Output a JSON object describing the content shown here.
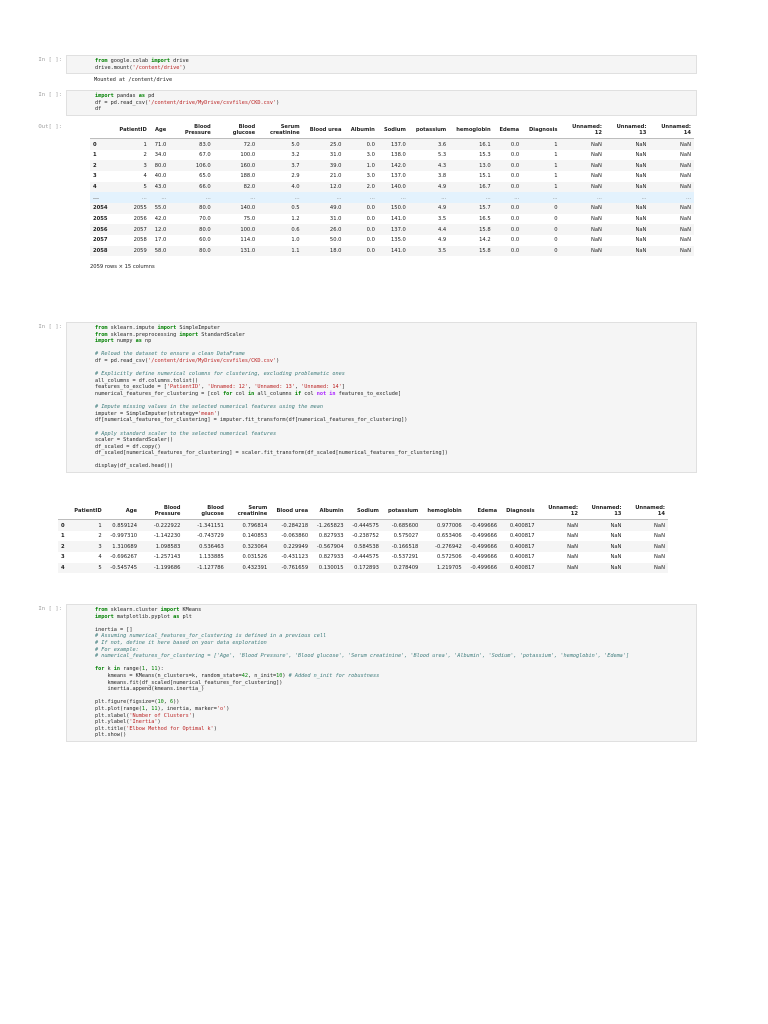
{
  "cells": [
    {
      "prompt": "In [ ]:",
      "code_lines": [
        [
          [
            "kw",
            "from"
          ],
          [
            "t",
            " google.colab "
          ],
          [
            "kw",
            "import"
          ],
          [
            "t",
            " drive"
          ]
        ],
        [
          [
            "t",
            "drive.mount("
          ],
          [
            "str",
            "'/content/drive'"
          ],
          [
            "t",
            ")"
          ]
        ]
      ],
      "output_text": "Mounted at /content/drive"
    },
    {
      "prompt": "In [ ]:",
      "code_lines": [
        [
          [
            "kw",
            "import"
          ],
          [
            "t",
            " pandas "
          ],
          [
            "kw",
            "as"
          ],
          [
            "t",
            " pd"
          ]
        ],
        [
          [
            "t",
            "df = pd.read_csv("
          ],
          [
            "str",
            "'/content/drive/MyDrive/csvfiles/CKD.csv'"
          ],
          [
            "t",
            ")"
          ]
        ],
        [
          [
            "t",
            "df"
          ]
        ]
      ]
    },
    {
      "prompt": "In [ ]:",
      "code_lines": [
        [
          [
            "kw",
            "from"
          ],
          [
            "t",
            " sklearn.impute "
          ],
          [
            "kw",
            "import"
          ],
          [
            "t",
            " SimpleImputer"
          ]
        ],
        [
          [
            "kw",
            "from"
          ],
          [
            "t",
            " sklearn.preprocessing "
          ],
          [
            "kw",
            "import"
          ],
          [
            "t",
            " StandardScaler"
          ]
        ],
        [
          [
            "kw",
            "import"
          ],
          [
            "t",
            " numpy "
          ],
          [
            "kw",
            "as"
          ],
          [
            "t",
            " np"
          ]
        ],
        [],
        [
          [
            "cm",
            "# Reload the dataset to ensure a clean DataFrame"
          ]
        ],
        [
          [
            "t",
            "df = pd.read_csv("
          ],
          [
            "str",
            "'/content/drive/MyDrive/csvfiles/CKD.csv'"
          ],
          [
            "t",
            ")"
          ]
        ],
        [],
        [
          [
            "cm",
            "# Explicitly define numerical columns for clustering, excluding problematic ones"
          ]
        ],
        [
          [
            "t",
            "all_columns = df.columns.tolist()"
          ]
        ],
        [
          [
            "t",
            "features_to_exclude = ["
          ],
          [
            "str",
            "'PatientID'"
          ],
          [
            "t",
            ", "
          ],
          [
            "str",
            "'Unnamed: 12'"
          ],
          [
            "t",
            ", "
          ],
          [
            "str",
            "'Unnamed: 13'"
          ],
          [
            "t",
            ", "
          ],
          [
            "str",
            "'Unnamed: 14'"
          ],
          [
            "t",
            "]"
          ]
        ],
        [
          [
            "t",
            "numerical_features_for_clustering = [col "
          ],
          [
            "kw",
            "for"
          ],
          [
            "t",
            " col "
          ],
          [
            "kw",
            "in"
          ],
          [
            "t",
            " all_columns "
          ],
          [
            "kw",
            "if"
          ],
          [
            "t",
            " col "
          ],
          [
            "op",
            "not in"
          ],
          [
            "t",
            " features_to_exclude]"
          ]
        ],
        [],
        [
          [
            "cm",
            "# Impute missing values in the selected numerical features using the mean"
          ]
        ],
        [
          [
            "t",
            "imputer = SimpleImputer(strategy="
          ],
          [
            "str",
            "'mean'"
          ],
          [
            "t",
            ")"
          ]
        ],
        [
          [
            "t",
            "df[numerical_features_for_clustering] = imputer.fit_transform(df[numerical_features_for_clustering])"
          ]
        ],
        [],
        [
          [
            "cm",
            "# Apply standard scaler to the selected numerical features"
          ]
        ],
        [
          [
            "t",
            "scaler = StandardScaler()"
          ]
        ],
        [
          [
            "t",
            "df_scaled = df.copy()"
          ]
        ],
        [
          [
            "t",
            "df_scaled[numerical_features_for_clustering] = scaler.fit_transform(df_scaled[numerical_features_for_clustering])"
          ]
        ],
        [],
        [
          [
            "t",
            "display(df_scaled.head())"
          ]
        ]
      ]
    },
    {
      "prompt": "In [ ]:",
      "code_lines": [
        [
          [
            "kw",
            "from"
          ],
          [
            "t",
            " sklearn.cluster "
          ],
          [
            "kw",
            "import"
          ],
          [
            "t",
            " KMeans"
          ]
        ],
        [
          [
            "kw",
            "import"
          ],
          [
            "t",
            " matplotlib.pyplot "
          ],
          [
            "kw",
            "as"
          ],
          [
            "t",
            " plt"
          ]
        ],
        [],
        [
          [
            "t",
            "inertia = []"
          ]
        ],
        [
          [
            "cm",
            "# Assuming numerical_features_for_clustering is defined in a previous cell"
          ]
        ],
        [
          [
            "cm",
            "# If not, define it here based on your data exploration"
          ]
        ],
        [
          [
            "cm",
            "# For example:"
          ]
        ],
        [
          [
            "cm",
            "# numerical_features_for_clustering = ['Age', 'Blood Pressure', 'Blood glucose', 'Serum creatinine', 'Blood urea', 'Albumin', 'Sodium', 'potassium', 'hemoglobin', 'Edema']"
          ]
        ],
        [],
        [
          [
            "kw",
            "for"
          ],
          [
            "t",
            " k "
          ],
          [
            "kw",
            "in"
          ],
          [
            "t",
            " range("
          ],
          [
            "num",
            "1"
          ],
          [
            "t",
            ", "
          ],
          [
            "num",
            "11"
          ],
          [
            "t",
            "):"
          ]
        ],
        [
          [
            "t",
            "    kmeans = KMeans(n_clusters=k, random_state="
          ],
          [
            "num",
            "42"
          ],
          [
            "t",
            ", n_init="
          ],
          [
            "num",
            "10"
          ],
          [
            "t",
            ") "
          ],
          [
            "cm",
            "# Added n_init for robustness"
          ]
        ],
        [
          [
            "t",
            "    kmeans.fit(df_scaled[numerical_features_for_clustering])"
          ]
        ],
        [
          [
            "t",
            "    inertia.append(kmeans.inertia_)"
          ]
        ],
        [],
        [
          [
            "t",
            "plt.figure(figsize=("
          ],
          [
            "num",
            "10"
          ],
          [
            "t",
            ", "
          ],
          [
            "num",
            "6"
          ],
          [
            "t",
            "))"
          ]
        ],
        [
          [
            "t",
            "plt.plot(range("
          ],
          [
            "num",
            "1"
          ],
          [
            "t",
            ", "
          ],
          [
            "num",
            "11"
          ],
          [
            "t",
            "), inertia, marker="
          ],
          [
            "str",
            "'o'"
          ],
          [
            "t",
            ")"
          ]
        ],
        [
          [
            "t",
            "plt.xlabel("
          ],
          [
            "str",
            "'Number of Clusters'"
          ],
          [
            "t",
            ")"
          ]
        ],
        [
          [
            "t",
            "plt.ylabel("
          ],
          [
            "str",
            "'Inertia'"
          ],
          [
            "t",
            ")"
          ]
        ],
        [
          [
            "t",
            "plt.title("
          ],
          [
            "str",
            "'Elbow Method for Optimal k'"
          ],
          [
            "t",
            ")"
          ]
        ],
        [
          [
            "t",
            "plt.show()"
          ]
        ]
      ]
    }
  ],
  "out_prompt": "Out[ ]:",
  "df_table": {
    "headers": [
      "",
      "PatientID",
      "Age",
      "Blood Pressure",
      "Blood glucose",
      "Serum creatinine",
      "Blood urea",
      "Albumin",
      "Sodium",
      "potassium",
      "hemoglobin",
      "Edema",
      "Diagnosis",
      "Unnamed: 12",
      "Unnamed: 13",
      "Unnamed: 14"
    ],
    "rows": [
      [
        "0",
        "1",
        "71.0",
        "83.0",
        "72.0",
        "5.0",
        "25.0",
        "0.0",
        "137.0",
        "3.6",
        "16.1",
        "0.0",
        "1",
        "NaN",
        "NaN",
        "NaN"
      ],
      [
        "1",
        "2",
        "34.0",
        "67.0",
        "100.0",
        "3.2",
        "31.0",
        "3.0",
        "138.0",
        "5.3",
        "15.3",
        "0.0",
        "1",
        "NaN",
        "NaN",
        "NaN"
      ],
      [
        "2",
        "3",
        "80.0",
        "106.0",
        "160.0",
        "3.7",
        "39.0",
        "1.0",
        "142.0",
        "4.3",
        "13.0",
        "0.0",
        "1",
        "NaN",
        "NaN",
        "NaN"
      ],
      [
        "3",
        "4",
        "40.0",
        "65.0",
        "188.0",
        "2.9",
        "21.0",
        "3.0",
        "137.0",
        "3.8",
        "15.1",
        "0.0",
        "1",
        "NaN",
        "NaN",
        "NaN"
      ],
      [
        "4",
        "5",
        "43.0",
        "66.0",
        "82.0",
        "4.0",
        "12.0",
        "2.0",
        "140.0",
        "4.9",
        "16.7",
        "0.0",
        "1",
        "NaN",
        "NaN",
        "NaN"
      ],
      [
        "...",
        "...",
        "...",
        "...",
        "...",
        "...",
        "...",
        "...",
        "...",
        "...",
        "...",
        "...",
        "...",
        "...",
        "...",
        "..."
      ],
      [
        "2054",
        "2055",
        "55.0",
        "80.0",
        "140.0",
        "0.5",
        "49.0",
        "0.0",
        "150.0",
        "4.9",
        "15.7",
        "0.0",
        "0",
        "NaN",
        "NaN",
        "NaN"
      ],
      [
        "2055",
        "2056",
        "42.0",
        "70.0",
        "75.0",
        "1.2",
        "31.0",
        "0.0",
        "141.0",
        "3.5",
        "16.5",
        "0.0",
        "0",
        "NaN",
        "NaN",
        "NaN"
      ],
      [
        "2056",
        "2057",
        "12.0",
        "80.0",
        "100.0",
        "0.6",
        "26.0",
        "0.0",
        "137.0",
        "4.4",
        "15.8",
        "0.0",
        "0",
        "NaN",
        "NaN",
        "NaN"
      ],
      [
        "2057",
        "2058",
        "17.0",
        "60.0",
        "114.0",
        "1.0",
        "50.0",
        "0.0",
        "135.0",
        "4.9",
        "14.2",
        "0.0",
        "0",
        "NaN",
        "NaN",
        "NaN"
      ],
      [
        "2058",
        "2059",
        "58.0",
        "80.0",
        "131.0",
        "1.1",
        "18.0",
        "0.0",
        "141.0",
        "3.5",
        "15.8",
        "0.0",
        "0",
        "NaN",
        "NaN",
        "NaN"
      ]
    ],
    "shape_note": "2059 rows × 15 columns"
  },
  "scaled_table": {
    "headers": [
      "",
      "PatientID",
      "Age",
      "Blood Pressure",
      "Blood glucose",
      "Serum creatinine",
      "Blood urea",
      "Albumin",
      "Sodium",
      "potassium",
      "hemoglobin",
      "Edema",
      "Diagnosis",
      "Unnamed: 12",
      "Unnamed: 13",
      "Unnamed: 14"
    ],
    "rows": [
      [
        "0",
        "1",
        "0.859124",
        "-0.222922",
        "-1.341151",
        "0.796814",
        "-0.284218",
        "-1.265823",
        "-0.444575",
        "-0.685600",
        "0.977006",
        "-0.499666",
        "0.400817",
        "NaN",
        "NaN",
        "NaN"
      ],
      [
        "1",
        "2",
        "-0.997310",
        "-1.142230",
        "-0.743729",
        "0.140853",
        "-0.063860",
        "0.827933",
        "-0.238752",
        "0.575027",
        "0.653406",
        "-0.499666",
        "0.400817",
        "NaN",
        "NaN",
        "NaN"
      ],
      [
        "2",
        "3",
        "1.310689",
        "1.098583",
        "0.536463",
        "0.323064",
        "0.229949",
        "-0.567904",
        "0.584538",
        "-0.166518",
        "-0.276942",
        "-0.499666",
        "0.400817",
        "NaN",
        "NaN",
        "NaN"
      ],
      [
        "3",
        "4",
        "-0.696267",
        "-1.257143",
        "1.133885",
        "0.031526",
        "-0.431123",
        "0.827933",
        "-0.444575",
        "-0.537291",
        "0.572506",
        "-0.499666",
        "0.400817",
        "NaN",
        "NaN",
        "NaN"
      ],
      [
        "4",
        "5",
        "-0.545745",
        "-1.199686",
        "-1.127786",
        "0.432391",
        "-0.761659",
        "0.130015",
        "0.172893",
        "0.278409",
        "1.219705",
        "-0.499666",
        "0.400817",
        "NaN",
        "NaN",
        "NaN"
      ]
    ]
  }
}
